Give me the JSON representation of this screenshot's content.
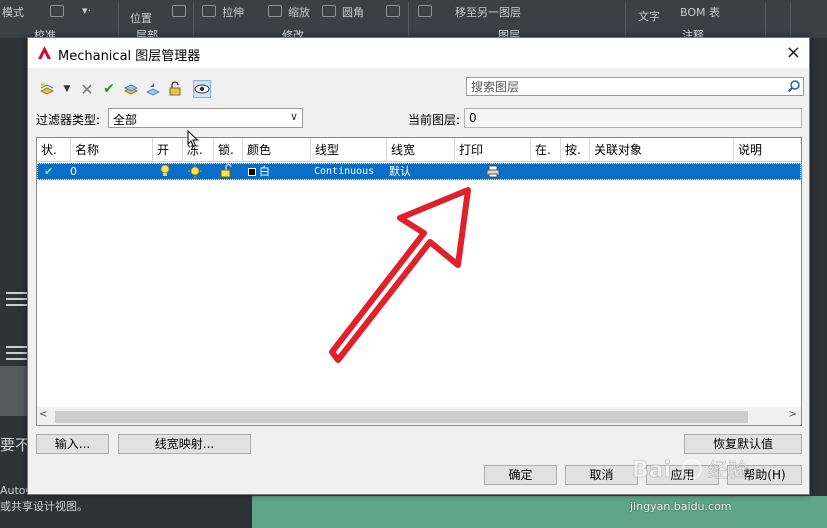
{
  "ribbon": {
    "items": [
      "模式",
      "位置",
      "拉伸",
      "缩放",
      "圆角",
      "移至另一图层",
      "文字",
      "BOM 表"
    ],
    "groups": [
      "校准",
      "层部",
      "修改",
      "图层",
      "注释"
    ]
  },
  "left_panel": {
    "text_1": "要不",
    "text_2": "AutoC",
    "text_3": "或共享设计视图。"
  },
  "dialog": {
    "title": "Mechanical 图层管理器",
    "close_glyph": "×",
    "search_placeholder": "搜索图层",
    "filter_label": "过滤器类型:",
    "filter_value": "全部",
    "current_layer_label": "当前图层:",
    "current_layer_value": "0",
    "columns": [
      "状.",
      "名称",
      "开",
      "冻.",
      "锁.",
      "颜色",
      "线型",
      "线宽",
      "打印",
      "在.",
      "按.",
      "关联对象",
      "说明"
    ],
    "rows": [
      {
        "status": "✔",
        "name": "0",
        "color_name": "白",
        "linetype": "Continuous",
        "lineweight": "默认"
      }
    ],
    "buttons": {
      "import": "输入...",
      "lineweight_map": "线宽映射...",
      "restore_defaults": "恢复默认值",
      "ok": "确定",
      "cancel": "取消",
      "apply": "应用",
      "help": "帮助(H)"
    }
  },
  "watermark": {
    "text": "jingyan.baidu.com"
  },
  "colors": {
    "selection": "#0a6ec9",
    "annotation_arrow": "#e0202a",
    "ribbon_bg": "#3b3f46",
    "accent_red": "#c8102e"
  }
}
